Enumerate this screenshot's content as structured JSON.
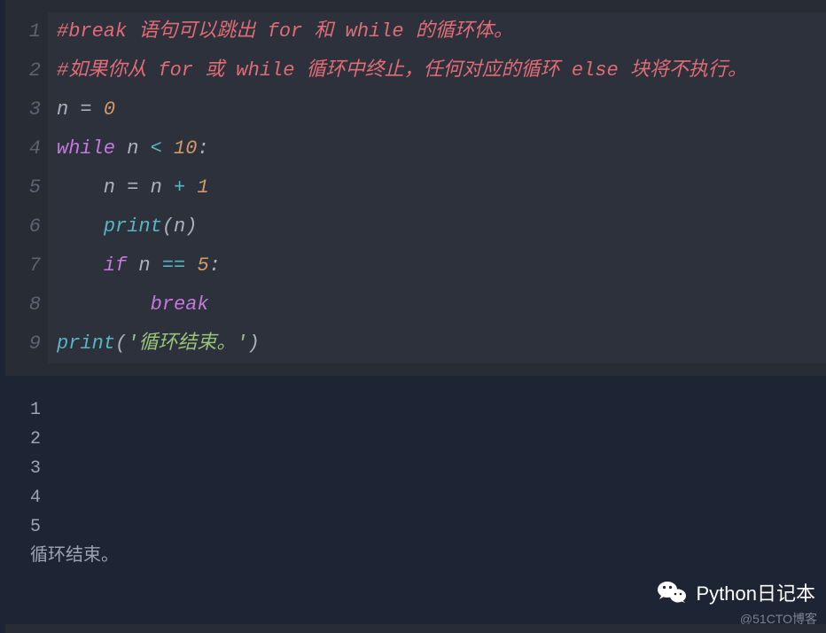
{
  "code": {
    "lines": [
      {
        "n": "1",
        "tokens": [
          {
            "t": "#break 语句可以跳出 for 和 while 的循环体。",
            "c": "tok-comment"
          }
        ]
      },
      {
        "n": "2",
        "tokens": [
          {
            "t": "#如果你从 for 或 while 循环中终止，任何对应的循环 else 块将不执行。",
            "c": "tok-comment"
          }
        ]
      },
      {
        "n": "3",
        "tokens": [
          {
            "t": "n ",
            "c": "tok-ident"
          },
          {
            "t": "=",
            "c": "tok-op"
          },
          {
            "t": " ",
            "c": "tok-ident"
          },
          {
            "t": "0",
            "c": "tok-num"
          }
        ]
      },
      {
        "n": "4",
        "tokens": [
          {
            "t": "while",
            "c": "tok-kw"
          },
          {
            "t": " n ",
            "c": "tok-ident"
          },
          {
            "t": "<",
            "c": "tok-opc"
          },
          {
            "t": " ",
            "c": "tok-ident"
          },
          {
            "t": "10",
            "c": "tok-num"
          },
          {
            "t": ":",
            "c": "tok-punc"
          }
        ]
      },
      {
        "n": "5",
        "tokens": [
          {
            "t": "    n ",
            "c": "tok-ident"
          },
          {
            "t": "=",
            "c": "tok-op"
          },
          {
            "t": " n ",
            "c": "tok-ident"
          },
          {
            "t": "+",
            "c": "tok-opc"
          },
          {
            "t": " ",
            "c": "tok-ident"
          },
          {
            "t": "1",
            "c": "tok-num"
          }
        ]
      },
      {
        "n": "6",
        "tokens": [
          {
            "t": "    ",
            "c": "tok-ident"
          },
          {
            "t": "print",
            "c": "tok-fn"
          },
          {
            "t": "(",
            "c": "tok-punc"
          },
          {
            "t": "n",
            "c": "tok-ident"
          },
          {
            "t": ")",
            "c": "tok-punc"
          }
        ]
      },
      {
        "n": "7",
        "tokens": [
          {
            "t": "    ",
            "c": "tok-ident"
          },
          {
            "t": "if",
            "c": "tok-kw"
          },
          {
            "t": " n ",
            "c": "tok-ident"
          },
          {
            "t": "==",
            "c": "tok-opc"
          },
          {
            "t": " ",
            "c": "tok-ident"
          },
          {
            "t": "5",
            "c": "tok-num"
          },
          {
            "t": ":",
            "c": "tok-punc"
          }
        ]
      },
      {
        "n": "8",
        "tokens": [
          {
            "t": "        ",
            "c": "tok-ident"
          },
          {
            "t": "break",
            "c": "tok-kw"
          }
        ]
      },
      {
        "n": "9",
        "tokens": [
          {
            "t": "print",
            "c": "tok-fn"
          },
          {
            "t": "(",
            "c": "tok-punc"
          },
          {
            "t": "'循环结束。'",
            "c": "tok-str"
          },
          {
            "t": ")",
            "c": "tok-punc"
          }
        ]
      }
    ]
  },
  "output": {
    "lines": [
      "1",
      "2",
      "3",
      "4",
      "5",
      "循环结束。"
    ]
  },
  "watermark": {
    "title": "Python日记本",
    "sub": "@51CTO博客"
  }
}
